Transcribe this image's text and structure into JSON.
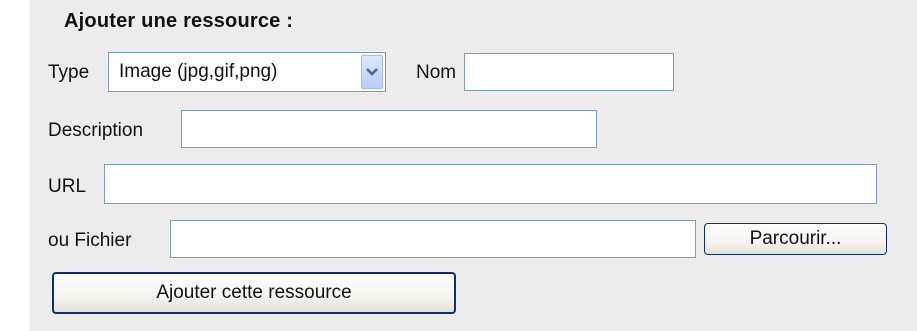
{
  "form": {
    "heading": "Ajouter une ressource :",
    "type_label": "Type",
    "type_selected": "Image (jpg,gif,png)",
    "name_label": "Nom",
    "name_value": "",
    "description_label": "Description",
    "description_value": "",
    "url_label": "URL",
    "url_value": "",
    "file_label": "ou Fichier",
    "file_value": "",
    "browse_label": "Parcourir...",
    "submit_label": "Ajouter cette ressource"
  },
  "icons": {
    "dropdown": "chevron-down-icon"
  },
  "colors": {
    "panel_background": "#ececec",
    "field_border": "#7f9db9",
    "button_border": "#0d2f6e",
    "dropdown_arrow": "#4d6185"
  }
}
